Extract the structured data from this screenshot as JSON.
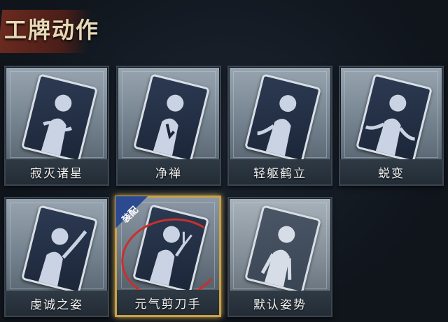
{
  "header": {
    "title": "工牌动作"
  },
  "cards": [
    {
      "id": "card-1",
      "label": "寂灭诸星",
      "pose": "orbs"
    },
    {
      "id": "card-2",
      "label": "净禅",
      "pose": "zen"
    },
    {
      "id": "card-3",
      "label": "轻躯鹤立",
      "pose": "crane"
    },
    {
      "id": "card-4",
      "label": "蜕变",
      "pose": "spread"
    },
    {
      "id": "card-5",
      "label": "虔诚之姿",
      "pose": "raise"
    },
    {
      "id": "card-6",
      "label": "元气剪刀手",
      "pose": "peace",
      "equipped": true,
      "equip_label": "装配"
    },
    {
      "id": "card-7",
      "label": "默认姿势",
      "pose": "default"
    }
  ],
  "colors": {
    "equipped_border": "#c9a24a",
    "equip_tag": "#2c4a8f",
    "annotation_circle": "#c8302b"
  }
}
